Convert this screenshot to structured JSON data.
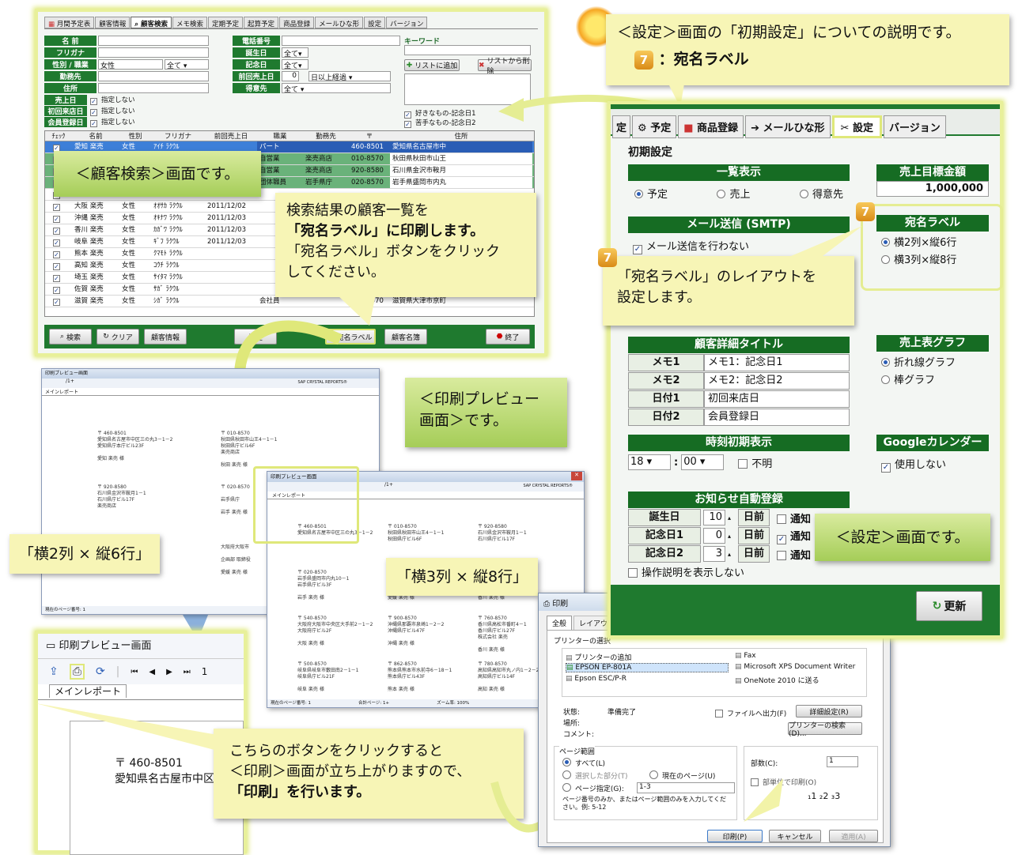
{
  "search_screen": {
    "tabs": [
      "月間予定表",
      "顧客情報",
      "顧客検索",
      "メモ検索",
      "定期予定",
      "起算予定",
      "商品登録",
      "メールひな形",
      "設定",
      "バージョン"
    ],
    "fields": {
      "name": "名 前",
      "furigana": "フリガナ",
      "gender_job": "性別 / 職業",
      "gender_value": "女性",
      "job_value": "全て",
      "workplace": "勤務先",
      "address": "住所",
      "phone": "電話番号",
      "birthday": "誕生日",
      "anniversary": "記念日",
      "last_sale": "前回売上日",
      "client": "得意先",
      "all": "全て",
      "days_value": "0",
      "days_label": "日以上経過",
      "keyword": "キーワード",
      "add_list": "リストに追加",
      "del_list": "リストから削除"
    },
    "date_filters": [
      {
        "label": "売上日",
        "text": "指定しない"
      },
      {
        "label": "初回来店日",
        "text": "指定しない"
      },
      {
        "label": "会員登録日",
        "text": "指定しない"
      }
    ],
    "likes": [
      "好きなもの-記念日1",
      "苦手なもの-記念日2"
    ],
    "headers": [
      "ﾁｪｯｸ",
      "名前",
      "性別",
      "フリガナ",
      "前回売上日",
      "職業",
      "勤務先",
      "〒",
      "住所"
    ],
    "rows": [
      [
        "愛知 楽売",
        "女性",
        "ｱｲﾁ ﾗｸｳﾙ",
        "",
        "パート",
        "",
        "460-8501",
        "愛知県名古屋市中"
      ],
      [
        "",
        "",
        "",
        "2011/12/08",
        "自営業",
        "楽売商店",
        "010-8570",
        "秋田県秋田市山王"
      ],
      [
        "",
        "",
        "",
        "2011/12/08",
        "自営業",
        "楽売商店",
        "920-8580",
        "石川県金沢市鞍月"
      ],
      [
        "",
        "",
        "",
        "2011/12/08",
        "団体職員",
        "岩手県庁",
        "020-8570",
        "岩手県盛岡市内丸"
      ],
      [
        "大分 楽売",
        "女性",
        "ｵｵｲﾀ ﾗｸｳﾙ",
        "2011/12/02",
        "",
        "",
        "",
        ""
      ],
      [
        "大阪 楽売",
        "女性",
        "ｵｵｻｶ ﾗｸｳﾙ",
        "2011/12/02",
        "",
        "",
        "",
        ""
      ],
      [
        "沖縄 楽売",
        "女性",
        "ｵｷﾅﾜ ﾗｸｳﾙ",
        "2011/12/03",
        "",
        "",
        "",
        ""
      ],
      [
        "香川 楽売",
        "女性",
        "ｶｶﾞﾜ ﾗｸｳﾙ",
        "2011/12/03",
        "",
        "",
        "",
        ""
      ],
      [
        "岐阜 楽売",
        "女性",
        "ｷﾞﾌ ﾗｸｳﾙ",
        "2011/12/03",
        "",
        "",
        "",
        ""
      ],
      [
        "熊本 楽売",
        "女性",
        "ｸﾏﾓﾄ ﾗｸｳﾙ",
        "",
        "",
        "",
        "",
        ""
      ],
      [
        "高知 楽売",
        "女性",
        "ｺｳﾁ ﾗｸｳﾙ",
        "",
        "",
        "",
        "",
        ""
      ],
      [
        "埼玉 楽売",
        "女性",
        "ｻｲﾀﾏ ﾗｸｳﾙ",
        "",
        "",
        "",
        "",
        ""
      ],
      [
        "佐賀 楽売",
        "女性",
        "ｻｶﾞ ﾗｸｳﾙ",
        "",
        "",
        "",
        "",
        ""
      ],
      [
        "滋賀 楽売",
        "女性",
        "ｼｶﾞ ﾗｸｳﾙ",
        "",
        "会社員",
        "",
        "520-8570",
        "滋賀県大津市京町"
      ]
    ],
    "buttons": {
      "search": "検索",
      "clear": "クリア",
      "info": "顧客情報",
      "plan": "予定",
      "label": "宛名ラベル",
      "roster": "顧客名簿",
      "exit": "終了"
    }
  },
  "callouts": {
    "search": "＜顧客検索＞画面です。",
    "label_desc": [
      "検索結果の顧客一覧を",
      "「宛名ラベル」に印刷します。",
      "「宛名ラベル」ボタンをクリック",
      "してください。"
    ],
    "preview": "＜印刷プレビュー画面＞です。",
    "layout2x6": "「横2列 × 縦6行」",
    "layout3x8": "「横3列 × 縦8行」",
    "settings_intro": "＜設定＞画面の「初期設定」についての説明です。",
    "num": "7",
    "label_item": "：宛名ラベル",
    "label_layout": [
      "「宛名ラベル」のレイアウトを",
      "設定します。"
    ],
    "settings_screen": "＜設定＞画面です。",
    "print_desc": [
      "こちらのボタンをクリックすると",
      "＜印刷＞画面が立ち上がりますので、",
      "「印刷」を行います。"
    ]
  },
  "settings": {
    "tabs": [
      "予定",
      "商品登録",
      "メールひな形",
      "設定",
      "バージョン"
    ],
    "section": "初期設定",
    "list_title": "一覧表示",
    "list_opts": [
      "予定",
      "売上",
      "得意先"
    ],
    "goal_title": "売上目標金額",
    "goal_value": "1,000,000",
    "mail_title": "メール送信 (SMTP)",
    "mail_opt": "メール送信を行わない",
    "label_title": "宛名ラベル",
    "label_opts": [
      "横2列×縦6行",
      "横3列×縦8行"
    ],
    "detail_title": "顧客詳細タイトル",
    "detail_rows": [
      [
        "メモ1",
        "メモ1：記念日1"
      ],
      [
        "メモ2",
        "メモ2：記念日2"
      ],
      [
        "日付1",
        "初回来店日"
      ],
      [
        "日付2",
        "会員登録日"
      ]
    ],
    "graph_title": "売上表グラフ",
    "graph_opts": [
      "折れ線グラフ",
      "棒グラフ"
    ],
    "time_title": "時刻初期表示",
    "hour": "18",
    "minute": "00",
    "unknown": "不明",
    "google_title": "Googleカレンダー",
    "google_opt": "使用しない",
    "notice_title": "お知らせ自動登録",
    "notice_rows": [
      [
        "誕生日",
        "10",
        "日前",
        "通知"
      ],
      [
        "記念日1",
        "0",
        "日前",
        "通知"
      ],
      [
        "記念日2",
        "3",
        "日前",
        "通知"
      ]
    ],
    "help": "操作説明を表示しない",
    "update": "更新"
  },
  "preview": {
    "title": "印刷プレビュー画面",
    "tab": "メインレポート",
    "brand": "SAP CRYSTAL REPORTS®",
    "page": "/1+",
    "status": "現在のページ番号: 1",
    "total": "合計ページ: 1+",
    "zoom": "ズーム率: 100%",
    "labels_a": [
      [
        "〒 460-8501",
        "愛知県名古屋市中区三の丸3－1－2",
        "愛知県庁本庁ビル23F",
        "",
        "愛知 楽売 様"
      ],
      [
        "〒 010-8570",
        "秋田県秋田市山王4－1－1",
        "秋田県庁ビル6F",
        "楽売商店",
        "",
        "秋田 楽売 様"
      ],
      [
        "〒 920-8580",
        "石川県金沢市鞍月1－1",
        "石川県庁ビル17F",
        "楽売商店"
      ],
      [
        "〒 020-8570",
        "",
        "岩手県庁",
        "",
        "岩手 楽売 様"
      ],
      [
        "〒 870-8501",
        "大分県大分市",
        "大分県庁",
        "",
        "大分 楽売 様"
      ],
      [
        "",
        "大阪府大阪市",
        "",
        "企画部 取締役",
        "",
        "愛媛 楽売 様"
      ]
    ],
    "labels_b": [
      [
        "〒 460-8501",
        "愛知県名古屋市中区三の丸3－1－2"
      ],
      [
        "〒 010-8570",
        "秋田県秋田市山王4－1－1",
        "秋田県庁ビル6F"
      ],
      [
        "〒 920-8580",
        "石川県金沢市鞍月1－1",
        "石川県庁ビル17F"
      ],
      [
        "〒 020-8570",
        "岩手県盛岡市内丸10－1",
        "岩手県庁ビル3F",
        "",
        "岩手 楽売 様"
      ],
      [
        "〒 900-8570",
        "沖縄県那覇市泉崎1－2－2",
        "沖縄県庁ビル4F",
        "",
        "愛媛 楽売 様"
      ],
      [
        "〒 760-8570",
        "香川県高松市番町4－1",
        "香川県庁ビル27F",
        "",
        "香川 楽売 様"
      ],
      [
        "〒 540-8570",
        "大阪府大阪市中央区大手前2－1－2",
        "大阪府庁ビル2F",
        "",
        "大阪 楽売 様"
      ],
      [
        "〒 900-8570",
        "沖縄県那覇市泉崎1－2－2",
        "沖縄県庁ビル47F",
        "",
        "沖縄 楽売 様"
      ],
      [
        "〒 760-8570",
        "香川県高松市番町4－1",
        "香川県庁ビル27F",
        "株式会社 楽売",
        "",
        "香川 楽売 様"
      ],
      [
        "〒 500-8570",
        "岐阜県岐阜市藪田南2－1－1",
        "岐阜県庁ビル21F",
        "",
        "岐阜 楽売 様"
      ],
      [
        "〒 862-8570",
        "熊本県熊本市水前寺6－18－1",
        "熊本県庁ビル43F",
        "",
        "熊本 楽売 様"
      ],
      [
        "〒 780-8570",
        "高知県高知市丸ノ内1－2－20",
        "高知県庁ビル14F",
        "",
        "高知 楽売 様"
      ]
    ],
    "zoom_addr": [
      "〒 460-8501",
      "愛知県名古屋市中区"
    ]
  },
  "print": {
    "title": "印刷",
    "tabs": [
      "全般",
      "レイアウト"
    ],
    "printer_group": "プリンターの選択",
    "printers": [
      "プリンターの追加",
      "EPSON EP-801A",
      "Epson ESC/P-R",
      "Fax",
      "Microsoft XPS Document Writer",
      "OneNote 2010 に送る"
    ],
    "status_label": "状態:",
    "status_value": "準備完了",
    "place_label": "場所:",
    "comment_label": "コメント:",
    "file_out": "ファイルへ出力(F)",
    "detail_btn": "詳細設定(R)",
    "find_btn": "プリンターの検索(D)...",
    "range_group": "ページ範囲",
    "range_all": "すべて(L)",
    "range_sel": "選択した部分(T)",
    "range_cur": "現在のページ(U)",
    "range_pages": "ページ指定(G):",
    "range_value": "1-3",
    "range_note": "ページ番号のみか、またはページ範囲のみを入力してください。例: 5-12",
    "copies_label": "部数(C):",
    "copies_value": "1",
    "collate": "部単位で印刷(O)",
    "print_btn": "印刷(P)",
    "cancel_btn": "キャンセル",
    "apply_btn": "適用(A)"
  },
  "colors": {
    "accent": "#1f7a2f",
    "callout": "#f7f5b6",
    "glow": "#e8f09a"
  }
}
